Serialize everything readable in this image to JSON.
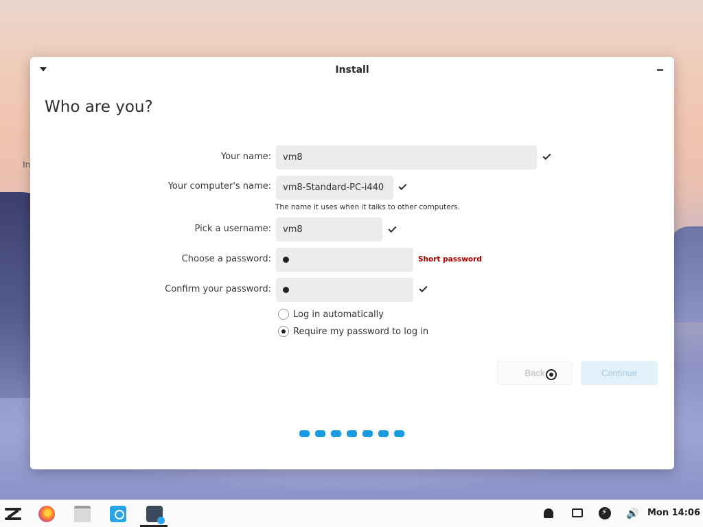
{
  "desktop": {
    "background_label": "In"
  },
  "window": {
    "title": "Install",
    "heading": "Who are you?"
  },
  "form": {
    "name_label": "Your name:",
    "name_value": "vm8",
    "computer_label": "Your computer's name:",
    "computer_value": "vm8-Standard-PC-i440",
    "computer_hint": "The name it uses when it talks to other computers.",
    "username_label": "Pick a username:",
    "username_value": "vm8",
    "password_label": "Choose a password:",
    "password_error": "Short password",
    "confirm_label": "Confirm your password:",
    "login_auto_label": "Log in automatically",
    "require_password_label": "Require my password to log in",
    "selected_login_option": "Require my password to log in"
  },
  "buttons": {
    "back_label": "Back",
    "continue_label": "Continue"
  },
  "progress": {
    "total_steps": 7
  },
  "taskbar": {
    "clock": "Mon 14:06",
    "apps": [
      "zorin-menu-icon",
      "firefox-icon",
      "files-icon",
      "software-store-icon",
      "installer-icon"
    ],
    "tray": [
      "bell-icon",
      "screen-icon",
      "power-icon",
      "volume-icon"
    ]
  },
  "colors": {
    "accent": "#1a9bdf",
    "error": "#a40000"
  }
}
